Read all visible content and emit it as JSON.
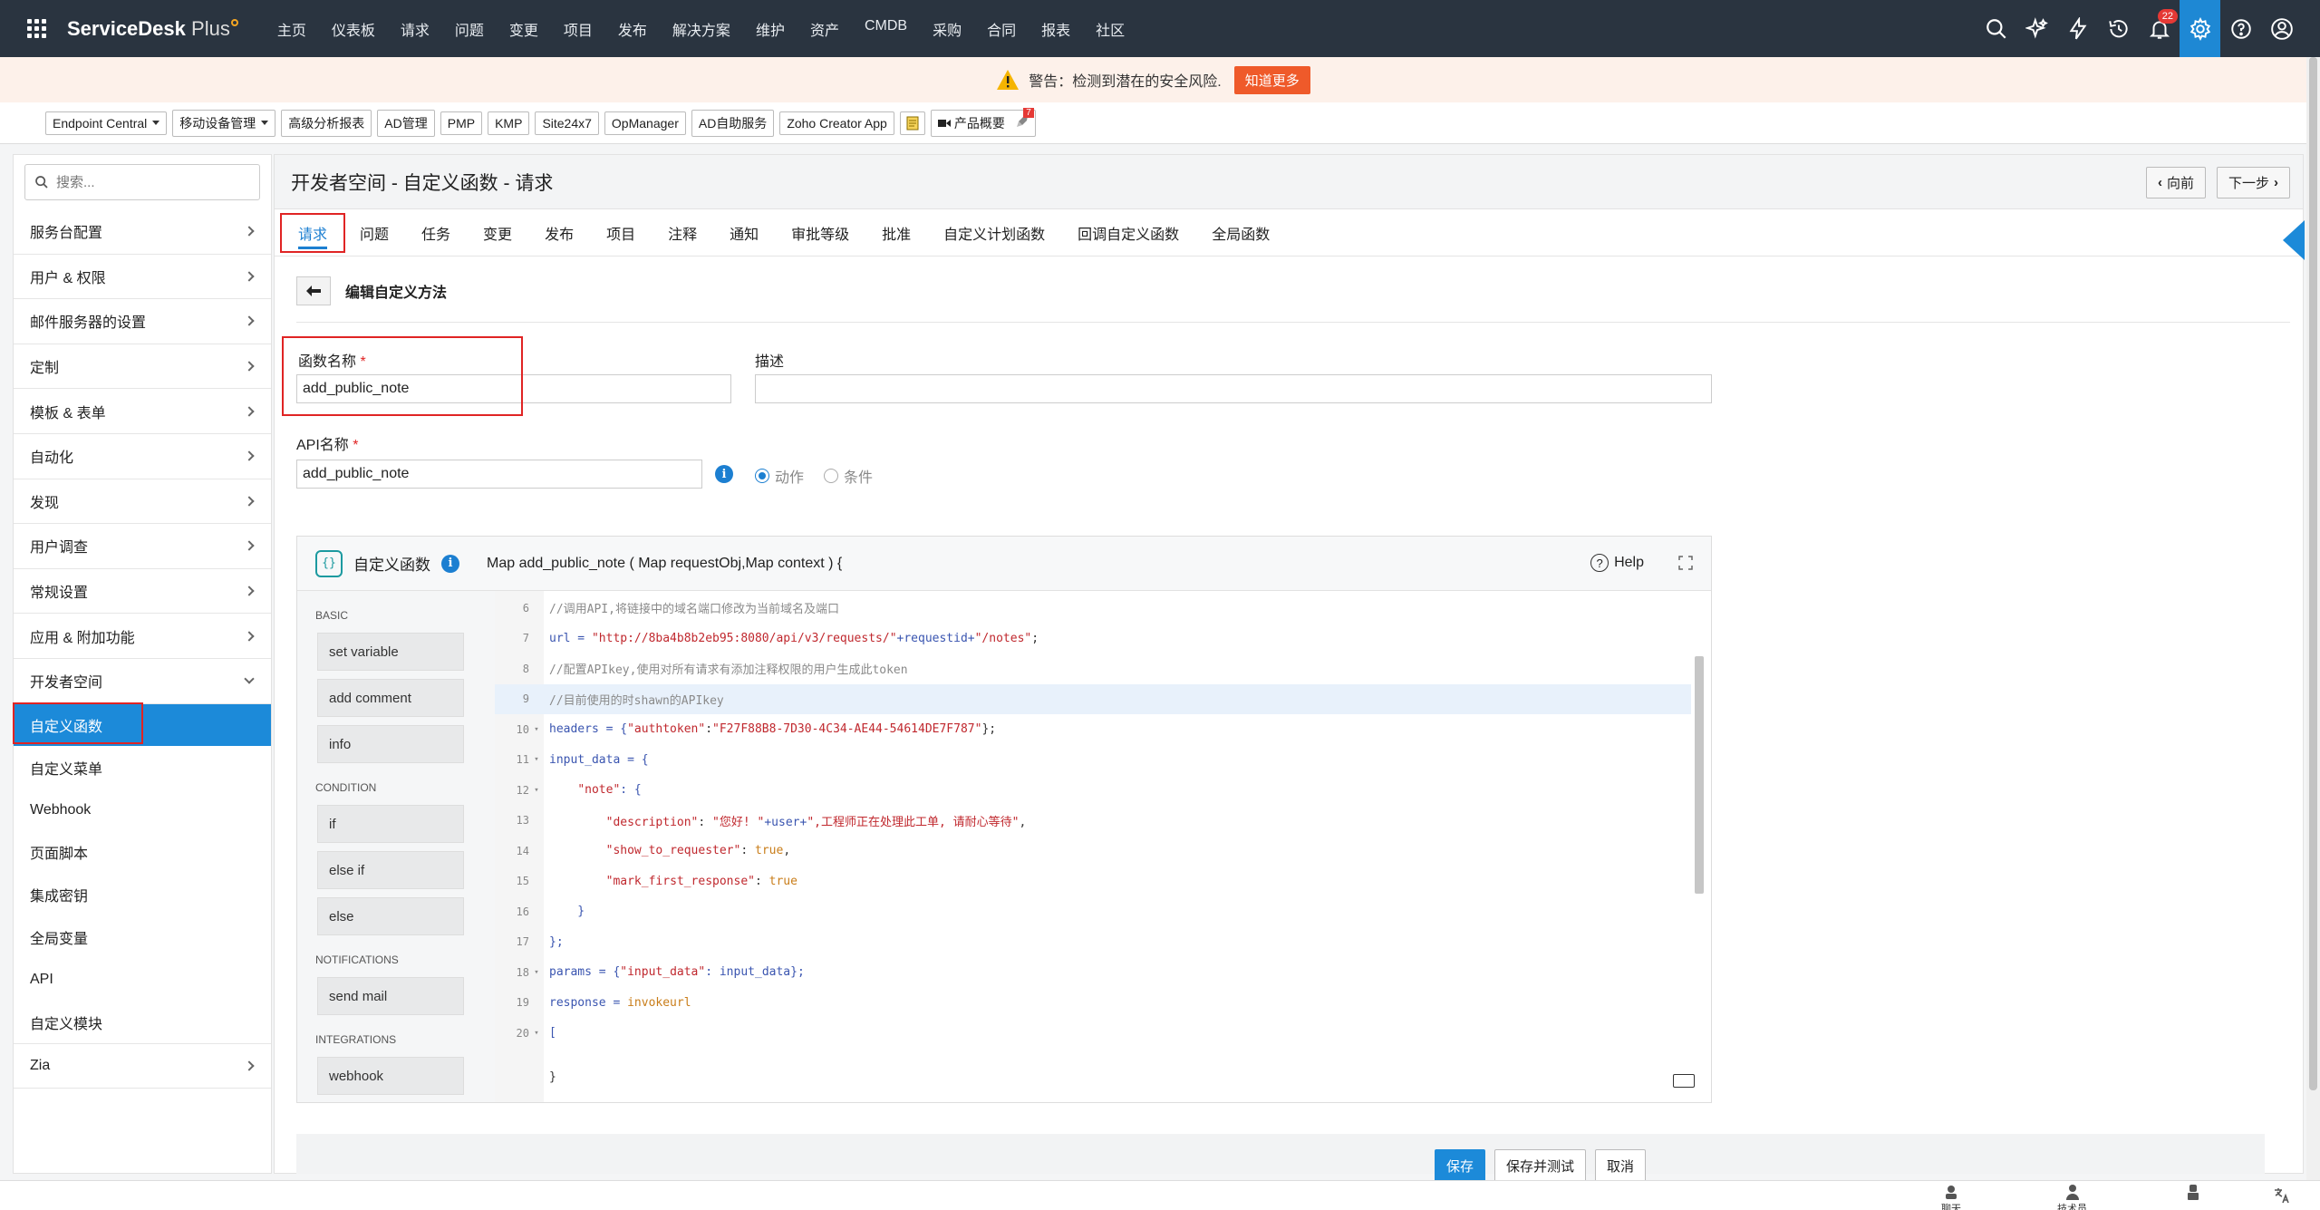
{
  "brand": {
    "name": "ServiceDesk",
    "suffix": "Plus"
  },
  "nav": [
    "主页",
    "仪表板",
    "请求",
    "问题",
    "变更",
    "项目",
    "发布",
    "解决方案",
    "维护",
    "资产",
    "CMDB",
    "采购",
    "合同",
    "报表",
    "社区"
  ],
  "top_icons": [
    "search-icon",
    "ai-sparkle-icon",
    "lightning-icon",
    "history-icon",
    "bell-icon",
    "gear-icon",
    "help-icon",
    "user-avatar-icon"
  ],
  "notification_count": "22",
  "warning": {
    "text": "警告：检测到潜在的安全风险.",
    "button": "知道更多"
  },
  "products": [
    "Endpoint Central",
    "移动设备管理",
    "高级分析报表",
    "AD管理",
    "PMP",
    "KMP",
    "Site24x7",
    "OpManager",
    "AD自助服务",
    "Zoho Creator App"
  ],
  "products_with_caret": [
    true,
    true,
    false,
    false,
    false,
    false,
    false,
    false,
    false,
    false
  ],
  "product_overview": "产品概要",
  "rocket_badge": "7",
  "sidebar": {
    "search_placeholder": "搜索...",
    "groups": [
      "服务台配置",
      "用户 & 权限",
      "邮件服务器的设置",
      "定制",
      "模板 & 表单",
      "自动化",
      "发现",
      "用户调查",
      "常规设置",
      "应用 & 附加功能"
    ],
    "expanded_group": "开发者空间",
    "sub_items": [
      "自定义函数",
      "自定义菜单",
      "Webhook",
      "页面脚本",
      "集成密钥",
      "全局变量",
      "API",
      "自定义模块"
    ],
    "active_sub": 0,
    "last_group": "Zia"
  },
  "page": {
    "title": "开发者空间 - 自定义函数 - 请求",
    "prev": "向前",
    "next": "下一步",
    "tabs": [
      "请求",
      "问题",
      "任务",
      "变更",
      "发布",
      "项目",
      "注释",
      "通知",
      "审批等级",
      "批准",
      "自定义计划函数",
      "回调自定义函数",
      "全局函数"
    ],
    "active_tab": 0,
    "subhead": "编辑自定义方法"
  },
  "form": {
    "func_name_label": "函数名称",
    "func_name_value": "add_public_note",
    "desc_label": "描述",
    "desc_value": "",
    "api_label": "API名称",
    "api_value": "add_public_note",
    "radio_action": "动作",
    "radio_condition": "条件"
  },
  "editor": {
    "title": "自定义函数",
    "signature": "Map add_public_note ( Map requestObj,Map context ) {",
    "help": "Help",
    "palette": [
      {
        "cat": "BASIC",
        "items": [
          "set variable",
          "add comment",
          "info"
        ]
      },
      {
        "cat": "CONDITION",
        "items": [
          "if",
          "else if",
          "else"
        ]
      },
      {
        "cat": "NOTIFICATIONS",
        "items": [
          "send mail"
        ]
      },
      {
        "cat": "INTEGRATIONS",
        "items": [
          "webhook"
        ]
      }
    ],
    "closing_brace": "}",
    "lines": [
      {
        "n": "6",
        "fold": "",
        "hl": false,
        "parts": [
          {
            "t": "//调用API,将链接中的域名端口修改为当前域名及端口",
            "c": "com"
          }
        ]
      },
      {
        "n": "7",
        "fold": "",
        "hl": false,
        "parts": [
          {
            "t": "url = ",
            "c": "var"
          },
          {
            "t": "\"http://8ba4b8b2eb95:8080/api/v3/requests/\"",
            "c": "str"
          },
          {
            "t": "+requestid+",
            "c": "var"
          },
          {
            "t": "\"/notes\"",
            "c": "str"
          },
          {
            "t": ";",
            "c": "pl"
          }
        ]
      },
      {
        "n": "8",
        "fold": "",
        "hl": false,
        "parts": [
          {
            "t": "//配置APIkey,使用对所有请求有添加注释权限的用户生成此token",
            "c": "com"
          }
        ]
      },
      {
        "n": "9",
        "fold": "",
        "hl": true,
        "parts": [
          {
            "t": "//目前使用的时shawn的APIkey",
            "c": "com"
          }
        ]
      },
      {
        "n": "10",
        "fold": "▾",
        "hl": false,
        "parts": [
          {
            "t": "headers = {",
            "c": "var"
          },
          {
            "t": "\"authtoken\"",
            "c": "str"
          },
          {
            "t": ":",
            "c": "pl"
          },
          {
            "t": "\"F27F88B8-7D30-4C34-AE44-54614DE7F787\"",
            "c": "str"
          },
          {
            "t": "};",
            "c": "pl"
          }
        ]
      },
      {
        "n": "11",
        "fold": "▾",
        "hl": false,
        "parts": [
          {
            "t": "input_data = {",
            "c": "var"
          }
        ]
      },
      {
        "n": "12",
        "fold": "▾",
        "hl": false,
        "parts": [
          {
            "t": "    ",
            "c": "pl"
          },
          {
            "t": "\"note\"",
            "c": "str"
          },
          {
            "t": ": {",
            "c": "var"
          }
        ]
      },
      {
        "n": "13",
        "fold": "",
        "hl": false,
        "parts": [
          {
            "t": "        ",
            "c": "pl"
          },
          {
            "t": "\"description\"",
            "c": "str"
          },
          {
            "t": ": ",
            "c": "pl"
          },
          {
            "t": "\"您好! \"",
            "c": "str"
          },
          {
            "t": "+user+",
            "c": "var"
          },
          {
            "t": "\",工程师正在处理此工单, 请耐心等待\"",
            "c": "str"
          },
          {
            "t": ",",
            "c": "pl"
          }
        ]
      },
      {
        "n": "14",
        "fold": "",
        "hl": false,
        "parts": [
          {
            "t": "        ",
            "c": "pl"
          },
          {
            "t": "\"show_to_requester\"",
            "c": "str"
          },
          {
            "t": ": ",
            "c": "pl"
          },
          {
            "t": "true",
            "c": "kw"
          },
          {
            "t": ",",
            "c": "pl"
          }
        ]
      },
      {
        "n": "15",
        "fold": "",
        "hl": false,
        "parts": [
          {
            "t": "        ",
            "c": "pl"
          },
          {
            "t": "\"mark_first_response\"",
            "c": "str"
          },
          {
            "t": ": ",
            "c": "pl"
          },
          {
            "t": "true",
            "c": "kw"
          }
        ]
      },
      {
        "n": "16",
        "fold": "",
        "hl": false,
        "parts": [
          {
            "t": "    }",
            "c": "var"
          }
        ]
      },
      {
        "n": "17",
        "fold": "",
        "hl": false,
        "parts": [
          {
            "t": "};",
            "c": "var"
          }
        ]
      },
      {
        "n": "18",
        "fold": "▾",
        "hl": false,
        "parts": [
          {
            "t": "params = {",
            "c": "var"
          },
          {
            "t": "\"input_data\"",
            "c": "str"
          },
          {
            "t": ": input_data};",
            "c": "var"
          }
        ]
      },
      {
        "n": "19",
        "fold": "",
        "hl": false,
        "parts": [
          {
            "t": "response = ",
            "c": "var"
          },
          {
            "t": "invokeurl",
            "c": "kw"
          }
        ]
      },
      {
        "n": "20",
        "fold": "▾",
        "hl": false,
        "parts": [
          {
            "t": "[",
            "c": "var"
          }
        ]
      }
    ]
  },
  "footer": {
    "save": "保存",
    "save_test": "保存并测试",
    "cancel": "取消"
  },
  "bottom_bar": [
    "聊天",
    "技术员",
    "",
    ""
  ]
}
